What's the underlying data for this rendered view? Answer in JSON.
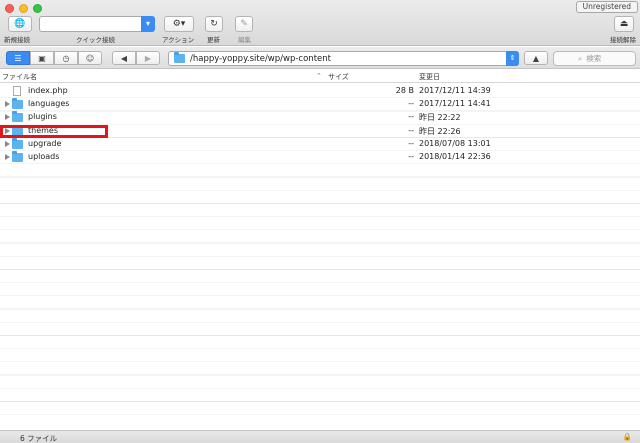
{
  "titlebar": {
    "unregistered": "Unregistered"
  },
  "toolbar": {
    "new_connection": "新規接続",
    "quick_connect": "クイック接続",
    "action": "アクション",
    "refresh": "更新",
    "edit": "編集",
    "disconnect": "接続解除",
    "quick_connect_value": ""
  },
  "nav": {
    "path": "/happy-yoppy.site/wp/wp-content",
    "search_placeholder": "検索"
  },
  "columns": {
    "name": "ファイル名",
    "size": "サイズ",
    "modified": "変更日"
  },
  "files": [
    {
      "name": "index.php",
      "size": "28 B",
      "modified": "2017/12/11 14:39",
      "type": "file"
    },
    {
      "name": "languages",
      "size": "--",
      "modified": "2017/12/11 14:41",
      "type": "folder"
    },
    {
      "name": "plugins",
      "size": "--",
      "modified": "昨日 22:22",
      "type": "folder"
    },
    {
      "name": "themes",
      "size": "--",
      "modified": "昨日 22:26",
      "type": "folder"
    },
    {
      "name": "upgrade",
      "size": "--",
      "modified": "2018/07/08 13:01",
      "type": "folder"
    },
    {
      "name": "uploads",
      "size": "--",
      "modified": "2018/01/14 22:36",
      "type": "folder"
    }
  ],
  "status": {
    "count": "6 ファイル"
  }
}
